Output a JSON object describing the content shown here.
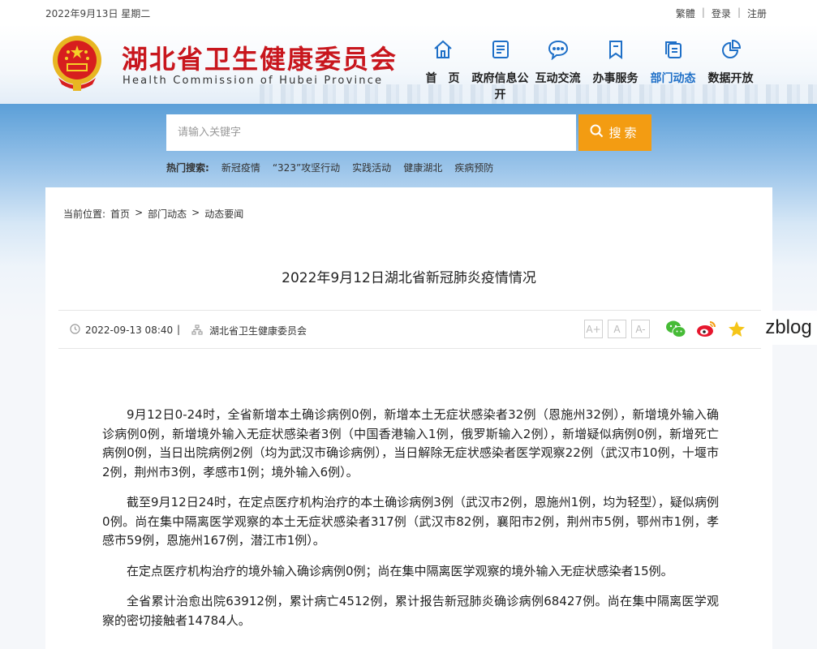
{
  "topbar": {
    "date": "2022年9月13日 星期二",
    "traditional": "繁體",
    "login": "登录",
    "register": "注册"
  },
  "header": {
    "title": "湖北省卫生健康委员会",
    "subtitle": "Health Commission of Hubei Province",
    "nav": [
      {
        "label": "首　页",
        "icon": "home-icon"
      },
      {
        "label": "政府信息公开",
        "icon": "document-icon"
      },
      {
        "label": "互动交流",
        "icon": "chat-icon"
      },
      {
        "label": "办事服务",
        "icon": "bookmark-icon"
      },
      {
        "label": "部门动态",
        "icon": "copy-icon",
        "active": true
      },
      {
        "label": "数据开放",
        "icon": "pie-chart-icon"
      }
    ],
    "active_color": "#1e6fc7",
    "title_color": "#c8161d"
  },
  "search": {
    "placeholder": "请输入关键字",
    "button_label": "搜索",
    "button_color": "#f39c12",
    "hot_label": "热门搜索:",
    "hot_terms": [
      "新冠疫情",
      "“323”攻坚行动",
      "实践活动",
      "健康湖北",
      "疾病预防"
    ]
  },
  "breadcrumb": {
    "prefix": "当前位置:",
    "items": [
      "首页",
      "部门动态",
      "动态要闻"
    ],
    "sep": ">"
  },
  "article": {
    "title": "2022年9月12日湖北省新冠肺炎疫情情况",
    "datetime": "2022-09-13 08:40",
    "source": "湖北省卫生健康委员会",
    "font_sizes": [
      "A+",
      "A",
      "A-"
    ],
    "share_icons": [
      "wechat-icon",
      "weibo-icon",
      "favorite-star-icon"
    ],
    "paragraphs": [
      "9月12日0-24时，全省新增本土确诊病例0例，新增本土无症状感染者32例（恩施州32例），新增境外输入确诊病例0例，新增境外输入无症状感染者3例（中国香港输入1例，俄罗斯输入2例），新增疑似病例0例，新增死亡病例0例，当日出院病例2例（均为武汉市确诊病例），当日解除无症状感染者医学观察22例（武汉市10例，十堰市2例，荆州市3例，孝感市1例；境外输入6例）。",
      "截至9月12日24时，在定点医疗机构治疗的本土确诊病例3例（武汉市2例，恩施州1例，均为轻型），疑似病例0例。尚在集中隔离医学观察的本土无症状感染者317例（武汉市82例，襄阳市2例，荆州市5例，鄂州市1例，孝感市59例，恩施州167例，潜江市1例）。",
      "在定点医疗机构治疗的境外输入确诊病例0例；尚在集中隔离医学观察的境外输入无症状感染者15例。",
      "全省累计治愈出院63912例，累计病亡4512例，累计报告新冠肺炎确诊病例68427例。尚在集中隔离医学观察的密切接触者14784人。"
    ]
  },
  "watermark": "zblog"
}
